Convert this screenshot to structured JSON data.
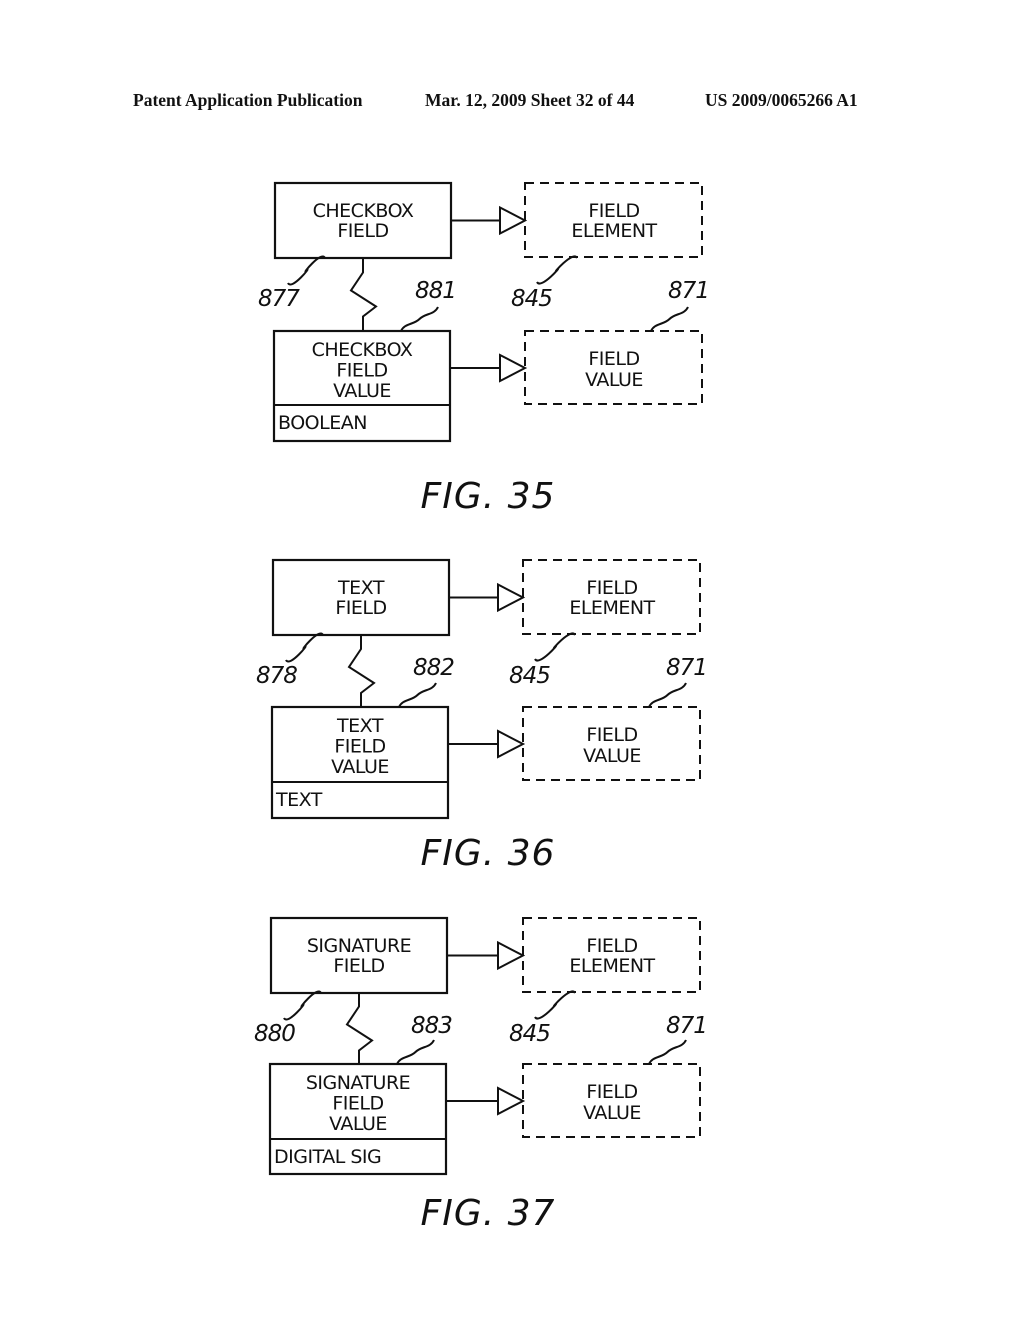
{
  "header": {
    "left": "Patent Application Publication",
    "middle": "Mar. 12, 2009  Sheet 32 of 44",
    "right": "US 2009/0065266 A1"
  },
  "figures": [
    {
      "caption": "FIG. 35",
      "field_box": {
        "lines": [
          "CHECKBOX",
          "FIELD"
        ],
        "ref": "877"
      },
      "value_box": {
        "lines": [
          "CHECKBOX",
          "FIELD",
          "VALUE"
        ],
        "type": "BOOLEAN",
        "ref": "881"
      },
      "element_box": {
        "lines": [
          "FIELD",
          "ELEMENT"
        ],
        "ref": "845"
      },
      "field_value_box": {
        "lines": [
          "FIELD",
          "VALUE"
        ],
        "ref": "871"
      }
    },
    {
      "caption": "FIG. 36",
      "field_box": {
        "lines": [
          "TEXT",
          "FIELD"
        ],
        "ref": "878"
      },
      "value_box": {
        "lines": [
          "TEXT",
          "FIELD",
          "VALUE"
        ],
        "type": "TEXT",
        "ref": "882"
      },
      "element_box": {
        "lines": [
          "FIELD",
          "ELEMENT"
        ],
        "ref": "845"
      },
      "field_value_box": {
        "lines": [
          "FIELD",
          "VALUE"
        ],
        "ref": "871"
      }
    },
    {
      "caption": "FIG. 37",
      "field_box": {
        "lines": [
          "SIGNATURE",
          "FIELD"
        ],
        "ref": "880"
      },
      "value_box": {
        "lines": [
          "SIGNATURE",
          "FIELD",
          "VALUE"
        ],
        "type": "DIGITAL SIG",
        "ref": "883"
      },
      "element_box": {
        "lines": [
          "FIELD",
          "ELEMENT"
        ],
        "ref": "845"
      },
      "field_value_box": {
        "lines": [
          "FIELD",
          "VALUE"
        ],
        "ref": "871"
      }
    }
  ]
}
